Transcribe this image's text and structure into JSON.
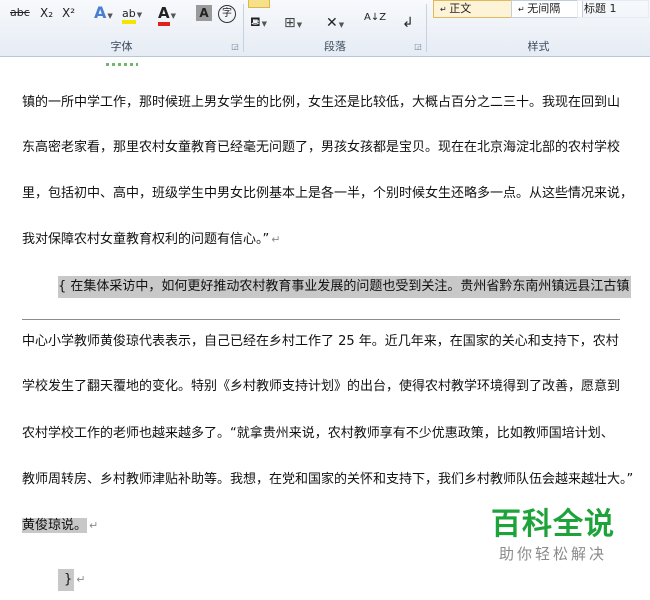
{
  "ribbon": {
    "font_group": {
      "label": "字体",
      "strike": "abc",
      "subscript": "X₂",
      "superscript": "X²",
      "text_effect": "A",
      "highlight": "ab",
      "font_color": "A",
      "char_shading": "A",
      "enclose": "字"
    },
    "paragraph_group": {
      "label": "段落",
      "sort": "A↓Z"
    },
    "style_group": {
      "label": "样式",
      "styles": [
        "正文",
        "无间隔",
        "标题 1"
      ]
    }
  },
  "document": {
    "lines": [
      "镇的一所中学工作，那时候班上男女学生的比例，女生还是比较低，大概占百分之二三十。我现在回到山",
      "东高密老家看，那里农村女童教育已经毫无问题了，男孩女孩都是宝贝。现在在北京海淀北部的农村学校",
      "里，包括初中、高中，班级学生中男女比例基本上是各一半，个别时候女生还略多一点。从这些情况来说，",
      "我对保障农村女童教育权利的问题有信心。”",
      "{ 在集体采访中，如何更好推动农村教育事业发展的问题也受到关注。贵州省黔东南州镇远县江古镇",
      "中心小学教师黄俊琼代表表示，自己已经在乡村工作了 25 年。近几年来，在国家的关心和支持下，农村",
      "学校发生了翻天覆地的变化。特别《乡村教师支持计划》的出台，使得农村教学环境得到了改善，愿意到",
      "农村学校工作的老师也越来越多了。“就拿贵州来说，农村教师享有不少优惠政策，比如教师国培计划、",
      "教师周转房、乡村教师津贴补助等。我想，在党和国家的关怀和支持下，我们乡村教师队伍会越来越壮大。”",
      "黄俊琼说。",
      "}"
    ],
    "paragraph_mark": "↵"
  },
  "watermark": {
    "title": "百科全说",
    "subtitle": "助你轻松解决"
  }
}
